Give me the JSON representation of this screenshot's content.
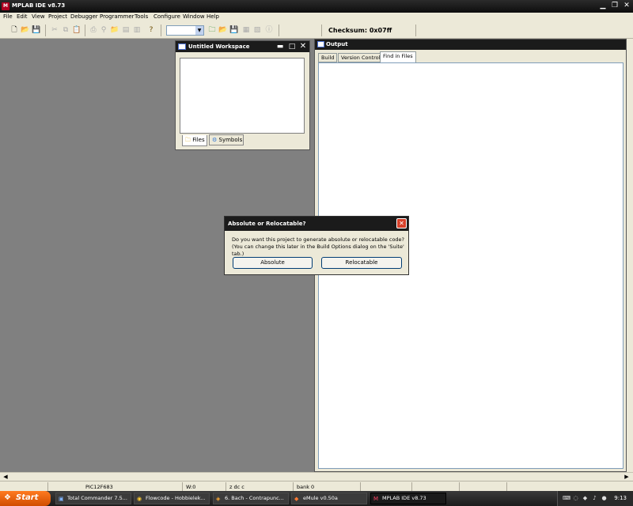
{
  "window": {
    "title": "MPLAB IDE v8.73",
    "app_icon": "mplab-logo-icon"
  },
  "menu": [
    "File",
    "Edit",
    "View",
    "Project",
    "Debugger",
    "Programmer",
    "Tools",
    "Configure",
    "Window",
    "Help"
  ],
  "toolbar": {
    "checksum": "Checksum:  0x07ff"
  },
  "workspace": {
    "title": "Untitled Workspace",
    "tab_files": "Files",
    "tab_symbols": "Symbols"
  },
  "output": {
    "title": "Output",
    "tabs": [
      "Build",
      "Version Control",
      "Find in Files"
    ],
    "active_tab": "Find in Files"
  },
  "dialog": {
    "title": "Absolute or Relocatable?",
    "line1": "Do you want this project to generate absolute or relocatable code?",
    "line2": "(You can change this later in the Build Options dialog on the 'Suite' tab.)",
    "absolute": "Absolute",
    "relocatable": "Relocatable"
  },
  "status": {
    "device": "PIC12F683",
    "w": "W:0",
    "flags": "z dc c",
    "bank": "bank 0"
  },
  "taskbar": {
    "start": "Start",
    "tasks": [
      "Total Commander 7.5...",
      "Flowcode - Hobbielek...",
      "6. Bach - Contrapunc...",
      "eMule v0.50a",
      "MPLAB IDE v8.73"
    ],
    "clock": "9:13"
  },
  "colors": {
    "titlebar": "#1b1b1b",
    "chrome": "#ece9d8",
    "desktop": "#808080",
    "close_button": "#d7412b",
    "start": "#e35f10"
  }
}
